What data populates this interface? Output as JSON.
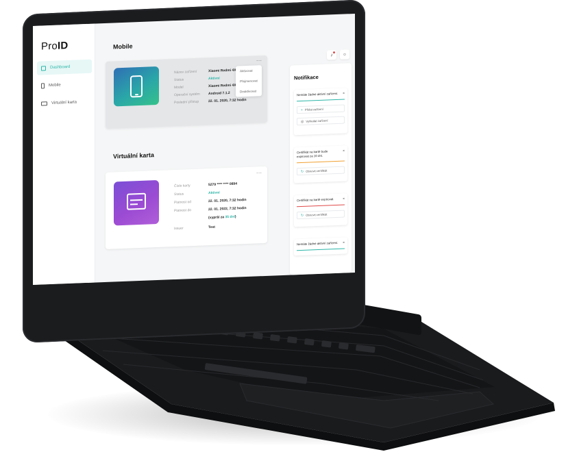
{
  "app": {
    "logo_pre": "Pro",
    "logo_bold": "ID"
  },
  "sidebar": {
    "items": [
      {
        "label": "Dashboard",
        "icon": "dashboard-icon",
        "active": true
      },
      {
        "label": "Mobile",
        "icon": "phone-icon",
        "active": false
      },
      {
        "label": "Virtuální karta",
        "icon": "card-icon",
        "active": false
      }
    ]
  },
  "mobile": {
    "title": "Mobile",
    "menu": "···",
    "fields": [
      {
        "label": "Název zařízení",
        "value": "Xiaomi Redmi 4X"
      },
      {
        "label": "Status",
        "value": "Aktivní"
      },
      {
        "label": "Model",
        "value": "Xiaomi Redmi 4X"
      },
      {
        "label": "Operační systém",
        "value": "Android 7.1.2"
      },
      {
        "label": "Poslední přístup",
        "value": "22. 01. 2020, 7:32 hodin"
      }
    ],
    "actions": [
      "Aktivovat",
      "Přejmenovat",
      "Deaktivovat"
    ]
  },
  "virtual_card": {
    "title": "Virtuální karta",
    "menu": "···",
    "fields": [
      {
        "label": "Číslo karty",
        "value": "5279 **** **** 0894"
      },
      {
        "label": "Status",
        "value": "Aktivní"
      },
      {
        "label": "Platnost od",
        "value": "22. 01. 2020, 7:32 hodin"
      },
      {
        "label": "Platnost do",
        "value": "22. 01. 2022, 7:32 hodin"
      },
      {
        "label": "Issuer",
        "value": "Test"
      }
    ],
    "expiry_note_pre": "(vyprší za ",
    "expiry_days": "35 dní",
    "expiry_note_post": ")"
  },
  "topbar": {
    "notification_icon": "bell-icon",
    "user_icon": "user-icon"
  },
  "notifications": {
    "title": "Notifikace",
    "items": [
      {
        "text": "Nemáte žádné aktivní zařízení.",
        "bar_color": "#2cb5a8",
        "buttons": [
          {
            "label": "Přidat zařízení",
            "icon": "plus-icon"
          },
          {
            "label": "Vyhledat zařízení",
            "icon": "locate-icon"
          }
        ]
      },
      {
        "text": "Certifikát na kartě bude expirovat za 10 dní.",
        "bar_color": "#f0a030",
        "buttons": [
          {
            "label": "Obnovit certifikát",
            "icon": "refresh-icon"
          }
        ]
      },
      {
        "text": "Certifikát na kartě expiroval.",
        "bar_color": "#e04848",
        "buttons": [
          {
            "label": "Obnovit certifikát",
            "icon": "refresh-icon"
          }
        ]
      },
      {
        "text": "Nemáte žádné aktivní zařízení.",
        "bar_color": "#2cb5a8",
        "buttons": []
      }
    ],
    "close": "×"
  },
  "colors": {
    "accent": "#2cb5a8",
    "warning": "#f0a030",
    "error": "#e04848",
    "mobile_tile": "#2a9ba8",
    "card_tile": "#8f4fd6"
  }
}
